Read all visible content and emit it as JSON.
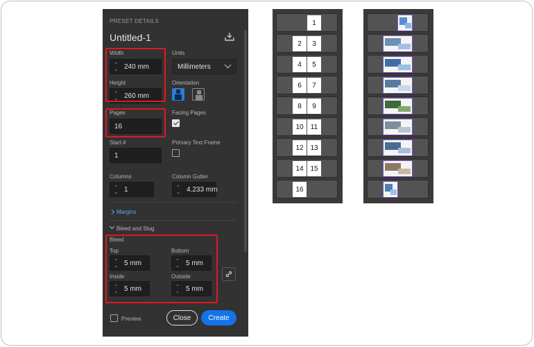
{
  "preset": {
    "section_title": "PRESET DETAILS",
    "doc_title": "Untitled-1",
    "width_label": "Width",
    "width_value": "240 mm",
    "height_label": "Height",
    "height_value": "260 mm",
    "units_label": "Units",
    "units_value": "Millimeters",
    "orientation_label": "Orientation",
    "pages_label": "Pages",
    "pages_value": "16",
    "facing_pages_label": "Facing Pages",
    "facing_pages_checked": true,
    "start_label": "Start #",
    "start_value": "1",
    "primary_text_frame_label": "Primary Text Frame",
    "primary_text_frame_checked": false,
    "columns_label": "Columns",
    "columns_value": "1",
    "gutter_label": "Column Gutter",
    "gutter_value": "4.233 mm",
    "margins_label": "Margins",
    "bleed_slug_label": "Bleed and Slug",
    "bleed_label": "Bleed",
    "top_label": "Top",
    "top_value": "5 mm",
    "bottom_label": "Bottom",
    "bottom_value": "5 mm",
    "inside_label": "Inside",
    "inside_value": "5 mm",
    "outside_label": "Outside",
    "outside_value": "5 mm",
    "preview_label": "Preview",
    "close_label": "Close",
    "create_label": "Create"
  },
  "page_spreads": [
    [
      "",
      "1"
    ],
    [
      "2",
      "3"
    ],
    [
      "4",
      "5"
    ],
    [
      "6",
      "7"
    ],
    [
      "8",
      "9"
    ],
    [
      "10",
      "11"
    ],
    [
      "12",
      "13"
    ],
    [
      "14",
      "15"
    ],
    [
      "16",
      ""
    ]
  ],
  "colors": {
    "panel_bg": "#323232",
    "accent_blue": "#1473e6",
    "highlight_red": "#e0191f",
    "thumb_outline": "#7b4fc8"
  }
}
